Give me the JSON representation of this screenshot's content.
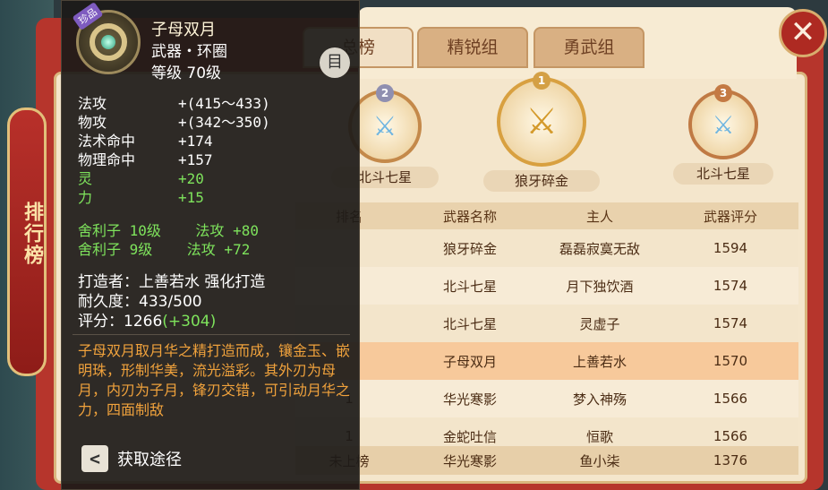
{
  "side_title": "排行榜",
  "tabs": [
    "总榜",
    "精锐组",
    "勇武组"
  ],
  "close_label": "✕",
  "podium": [
    {
      "rank": "2",
      "name": "北斗七星"
    },
    {
      "rank": "1",
      "name": "狼牙碎金"
    },
    {
      "rank": "3",
      "name": "北斗七星"
    }
  ],
  "table": {
    "headers": {
      "rank": "排名",
      "weapon": "武器名称",
      "owner": "主人",
      "score": "武器评分"
    },
    "rows": [
      {
        "rank": "",
        "weapon": "狼牙碎金",
        "owner": "磊磊寂寞无敌",
        "score": "1594"
      },
      {
        "rank": "",
        "weapon": "北斗七星",
        "owner": "月下独饮酒",
        "score": "1574"
      },
      {
        "rank": "",
        "weapon": "北斗七星",
        "owner": "灵虚子",
        "score": "1574"
      },
      {
        "rank": "",
        "weapon": "子母双月",
        "owner": "上善若水",
        "score": "1570"
      },
      {
        "rank": "1",
        "weapon": "华光寒影",
        "owner": "梦入神殇",
        "score": "1566"
      },
      {
        "rank": "1",
        "weapon": "金蛇吐信",
        "owner": "恒歌",
        "score": "1566"
      }
    ],
    "self_row": {
      "rank": "未上榜",
      "weapon": "华光寒影",
      "owner": "鱼小柒",
      "score": "1376"
    }
  },
  "tooltip": {
    "rare_tag": "珍品",
    "name": "子母双月",
    "type": "武器・环圈",
    "level": "等级 70级",
    "doc_icon": "目",
    "stats": [
      {
        "label": "法攻",
        "value": "+(415～433)",
        "green": false
      },
      {
        "label": "物攻",
        "value": "+(342～350)",
        "green": false
      },
      {
        "label": "法术命中",
        "value": "+174",
        "green": false
      },
      {
        "label": "物理命中",
        "value": "+157",
        "green": false
      },
      {
        "label": "灵",
        "value": "+20",
        "green": true
      },
      {
        "label": "力",
        "value": "+15",
        "green": true
      }
    ],
    "gems": [
      "舍利子 10级    法攻 +80",
      "舍利子 9级    法攻 +72"
    ],
    "crafter": "打造者：上善若水 强化打造",
    "durability": "耐久度：433/500",
    "score_label": "评分：1266",
    "score_bonus": "(+304)",
    "description": "子母双月取月华之精打造而成，镶金玉、嵌明珠，形制华美，流光溢彩。其外刃为母月，内刃为子月，锋刃交错，可引动月华之力，四面制敌",
    "source_button": "获取途径"
  },
  "colors": {
    "accent": "#b6352c",
    "green": "#7ee35c",
    "desc": "#f0a23c"
  }
}
